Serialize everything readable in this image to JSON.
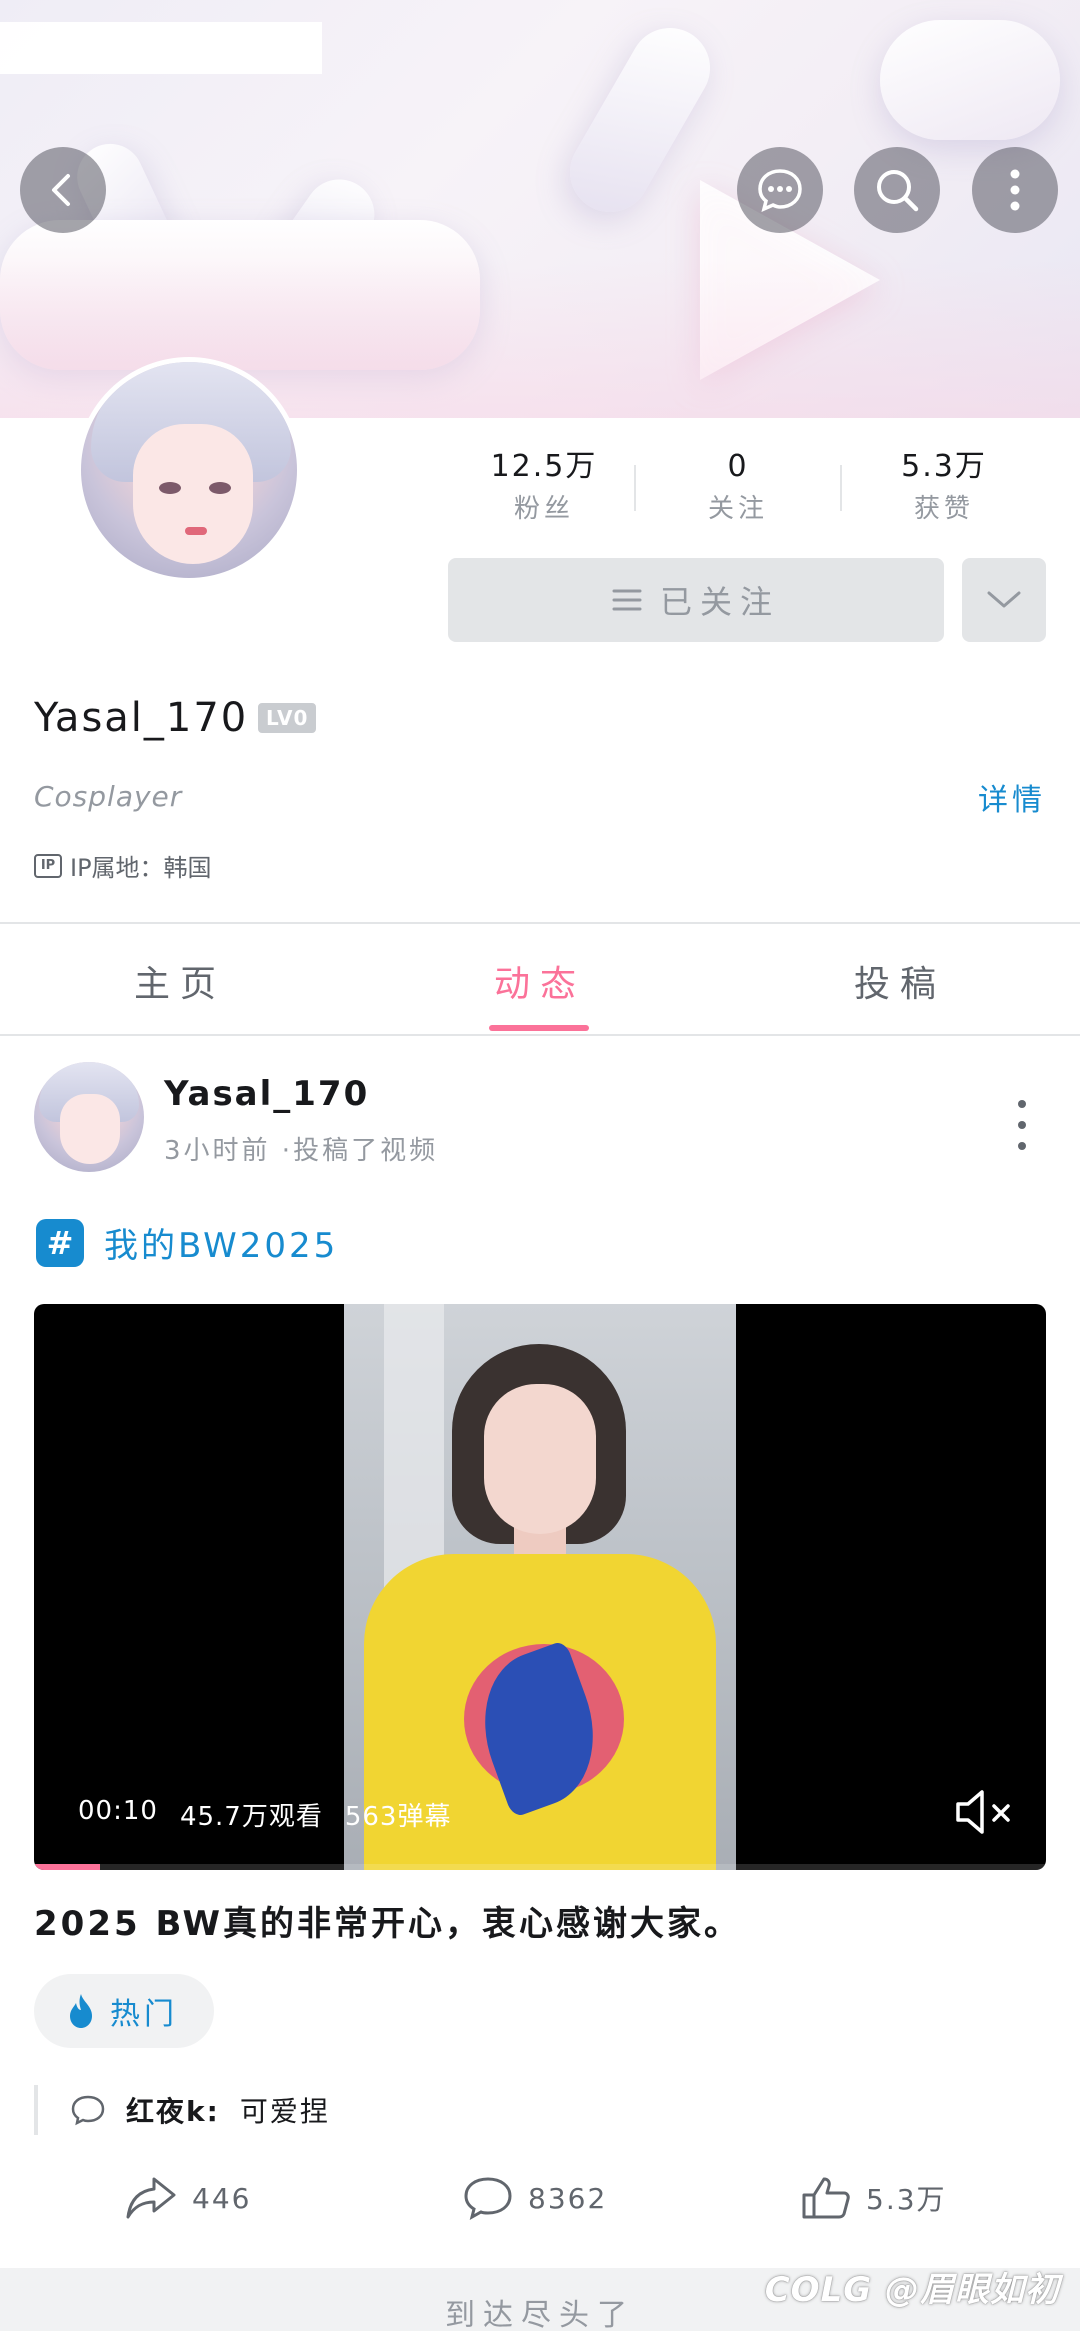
{
  "header": {
    "back_icon": "back-arrow-icon",
    "message_icon": "message-bubble-icon",
    "search_icon": "search-icon",
    "more_icon": "more-vertical-icon"
  },
  "profile": {
    "stats": [
      {
        "value": "12.5万",
        "label": "粉丝"
      },
      {
        "value": "0",
        "label": "关注"
      },
      {
        "value": "5.3万",
        "label": "获赞"
      }
    ],
    "follow_label": "已关注",
    "username": "Yasal_170",
    "level": "LV0",
    "bio": "Cosplayer",
    "detail_link": "详情",
    "ip_badge": "IP",
    "ip_location": "IP属地：韩国"
  },
  "tabs": [
    {
      "label": "主页",
      "active": false
    },
    {
      "label": "动态",
      "active": true
    },
    {
      "label": "投稿",
      "active": false
    }
  ],
  "post": {
    "author": "Yasal_170",
    "meta": "3小时前 ·投稿了视频",
    "topic": "我的BW2025",
    "video": {
      "time": "00:10",
      "views": "45.7万观看",
      "danmaku": "563弹幕",
      "progress": 0.065
    },
    "text": "2025 BW真的非常开心，衷心感谢大家。",
    "hot_tag": "热门",
    "comment": {
      "user": "红夜k:",
      "text": "可爱捏"
    },
    "actions": {
      "share": "446",
      "comments": "8362",
      "likes": "5.3万"
    }
  },
  "footer": {
    "end_text": "到达尽头了"
  },
  "watermark": "COLG @眉眼如初",
  "colors": {
    "accent_pink": "#fb7299",
    "link_blue": "#178bcf"
  }
}
